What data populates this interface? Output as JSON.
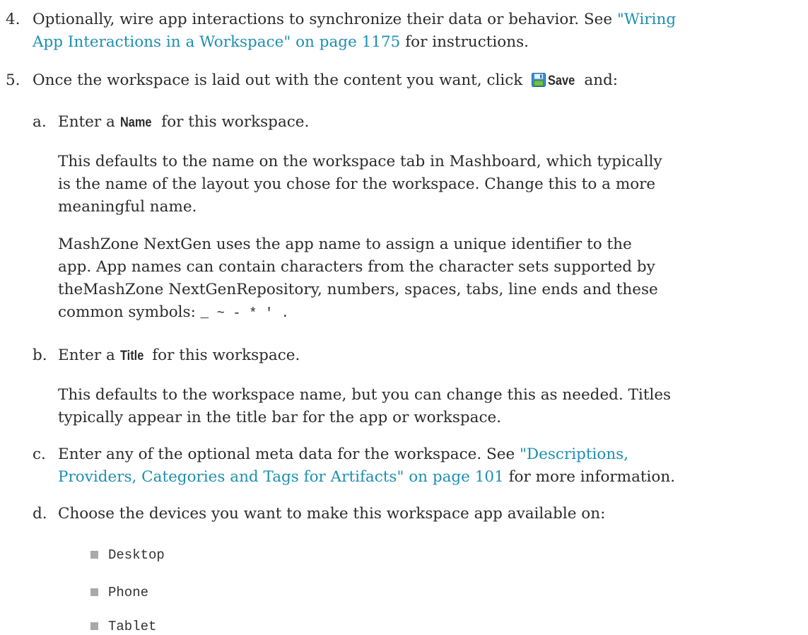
{
  "step4": {
    "number": "4.",
    "text": "Optionally, wire app interactions to synchronize their data or behavior. See ",
    "link_line1": "\"Wiring",
    "link_line2": "App Interactions in a Workspace\" on page 1175",
    "after_link": " for instructions."
  },
  "step5": {
    "number": "5.",
    "text_before": "Once the workspace is laid out with the content you want, click ",
    "save_label": "Save",
    "text_after": " and:",
    "save_icon": "save-floppy-icon"
  },
  "sub_a": {
    "letter": "a.",
    "text_before": "Enter a ",
    "ui_label": "Name",
    "text_after": " for this workspace.",
    "para1_line1": "This defaults to the name on the workspace tab in Mashboard, which typically",
    "para1_line2": "is the name of the layout you chose for the workspace. Change this to a more",
    "para1_line3": "meaningful name.",
    "para2_line1": "MashZone NextGen uses the app name to assign a unique identifier to the",
    "para2_line2": "app. App names can contain characters from the character sets supported by",
    "para2_line3": "theMashZone NextGenRepository, numbers, spaces, tabs, line ends and these",
    "para2_line4": "common symbols: ",
    "symbols": "_ ~ - * ' ."
  },
  "sub_b": {
    "letter": "b.",
    "text_before": "Enter a ",
    "ui_label": "Title",
    "text_after": " for this workspace.",
    "para_line1": "This defaults to the workspace name, but you can change this as needed. Titles",
    "para_line2": "typically appear in the title bar for the app or workspace."
  },
  "sub_c": {
    "letter": "c.",
    "line1": "Enter any of the optional meta data for the workspace. See ",
    "link_line1": "\"Descriptions,",
    "link_line2": "Providers, Categories and Tags for Artifacts\" on page 101",
    "after_link": " for more information."
  },
  "sub_d": {
    "letter": "d.",
    "text": "Choose the devices you want to make this workspace app available on:"
  },
  "devices": [
    "Desktop",
    "Phone",
    "Tablet"
  ]
}
